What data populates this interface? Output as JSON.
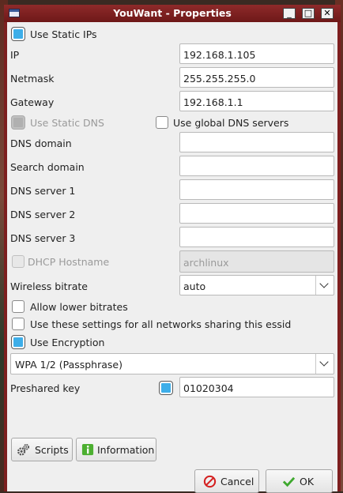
{
  "window": {
    "title": "YouWant - Properties",
    "controls": {
      "minimize": "_",
      "maximize": "□",
      "close": "✕"
    }
  },
  "static_ips": {
    "label": "Use Static IPs",
    "checked": true
  },
  "fields": {
    "ip": {
      "label": "IP",
      "value": "192.168.1.105"
    },
    "netmask": {
      "label": "Netmask",
      "value": "255.255.255.0"
    },
    "gateway": {
      "label": "Gateway",
      "value": "192.168.1.1"
    }
  },
  "static_dns": {
    "label": "Use Static DNS",
    "checked": true,
    "enabled": false
  },
  "global_dns": {
    "label": "Use global DNS servers",
    "checked": false
  },
  "dns": {
    "domain": {
      "label": "DNS domain",
      "value": ""
    },
    "search": {
      "label": "Search domain",
      "value": ""
    },
    "server1": {
      "label": "DNS server 1",
      "value": ""
    },
    "server2": {
      "label": "DNS server 2",
      "value": ""
    },
    "server3": {
      "label": "DNS server 3",
      "value": ""
    }
  },
  "dhcp": {
    "label": "DHCP Hostname",
    "value": "archlinux",
    "checked": false,
    "enabled": false
  },
  "bitrate": {
    "label": "Wireless bitrate",
    "value": "auto"
  },
  "lower_bitrates": {
    "label": "Allow lower bitrates",
    "checked": false
  },
  "share_settings": {
    "label": "Use these settings for all networks sharing this essid",
    "checked": false
  },
  "encryption": {
    "label": "Use Encryption",
    "checked": true,
    "type": "WPA 1/2 (Passphrase)"
  },
  "preshared": {
    "label": "Preshared key",
    "value": "01020304",
    "show": true
  },
  "buttons": {
    "scripts": "Scripts",
    "information": "Information",
    "cancel": "Cancel",
    "ok": "OK"
  },
  "colors": {
    "accent": "#3daee9",
    "titlebar": "#7d1f1f",
    "panel": "#efefef",
    "cancel_icon": "#d42020",
    "ok_icon": "#3ea82e",
    "info_icon": "#4caf30"
  }
}
